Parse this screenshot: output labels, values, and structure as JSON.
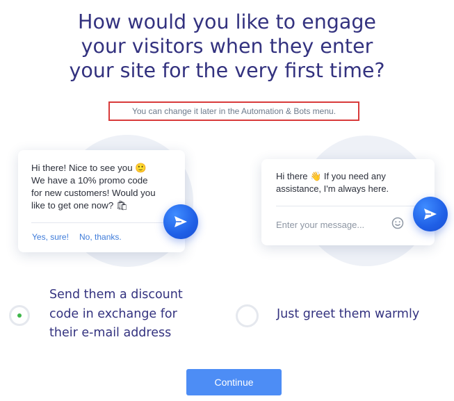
{
  "heading": {
    "line1": "How would you like to engage",
    "line2": "your visitors when they enter",
    "line3": "your site for the very first time?"
  },
  "subtitle": "You can change it later in the Automation & Bots menu.",
  "left_card": {
    "lines": [
      "Hi there! Nice to see you 🙂",
      "We have a 10% promo code",
      "for new customers! Would you",
      "like to get one now? 🛍"
    ],
    "reply_yes": "Yes, sure!",
    "reply_no": "No, thanks."
  },
  "right_card": {
    "line1": "Hi there 👋 If you need any",
    "line2": "assistance, I'm always here.",
    "input_placeholder": "Enter your message...",
    "emoji_icon": "smiley-icon"
  },
  "options": [
    {
      "lines": [
        "Send them a discount",
        "code in exchange for",
        "their e-mail address"
      ],
      "selected": true
    },
    {
      "lines": [
        "Just greet them warmly"
      ],
      "selected": false
    }
  ],
  "continue_label": "Continue",
  "colors": {
    "heading": "#33327f",
    "accent": "#4d8df5",
    "selected_dot": "#3fb64a",
    "highlight_border": "#d83a3a"
  }
}
